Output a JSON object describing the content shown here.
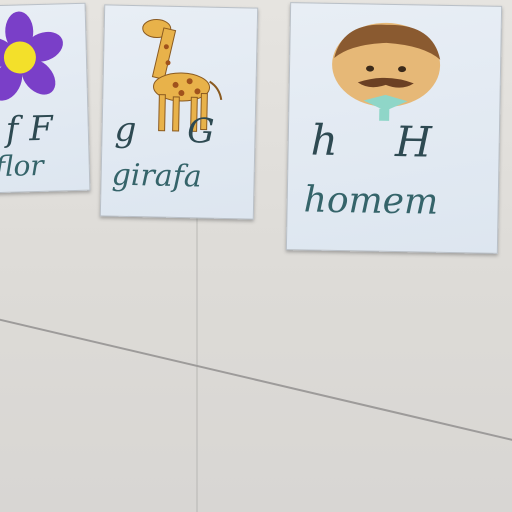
{
  "cards": [
    {
      "letters": "f F",
      "word": "flor",
      "picture": "purple-flower"
    },
    {
      "letters": "g G",
      "word": "girafa",
      "picture": "giraffe"
    },
    {
      "letters": "h H",
      "word": "homem",
      "picture": "man-face"
    }
  ],
  "colors": {
    "wall": "#e2e0dc",
    "card": "#e3eaf2",
    "script_text": "#35646a",
    "flower": "#7a3fc8",
    "flower_center": "#f3e02a",
    "giraffe": "#e8b24a",
    "skin": "#e6b877",
    "hair": "#8a5a30"
  }
}
